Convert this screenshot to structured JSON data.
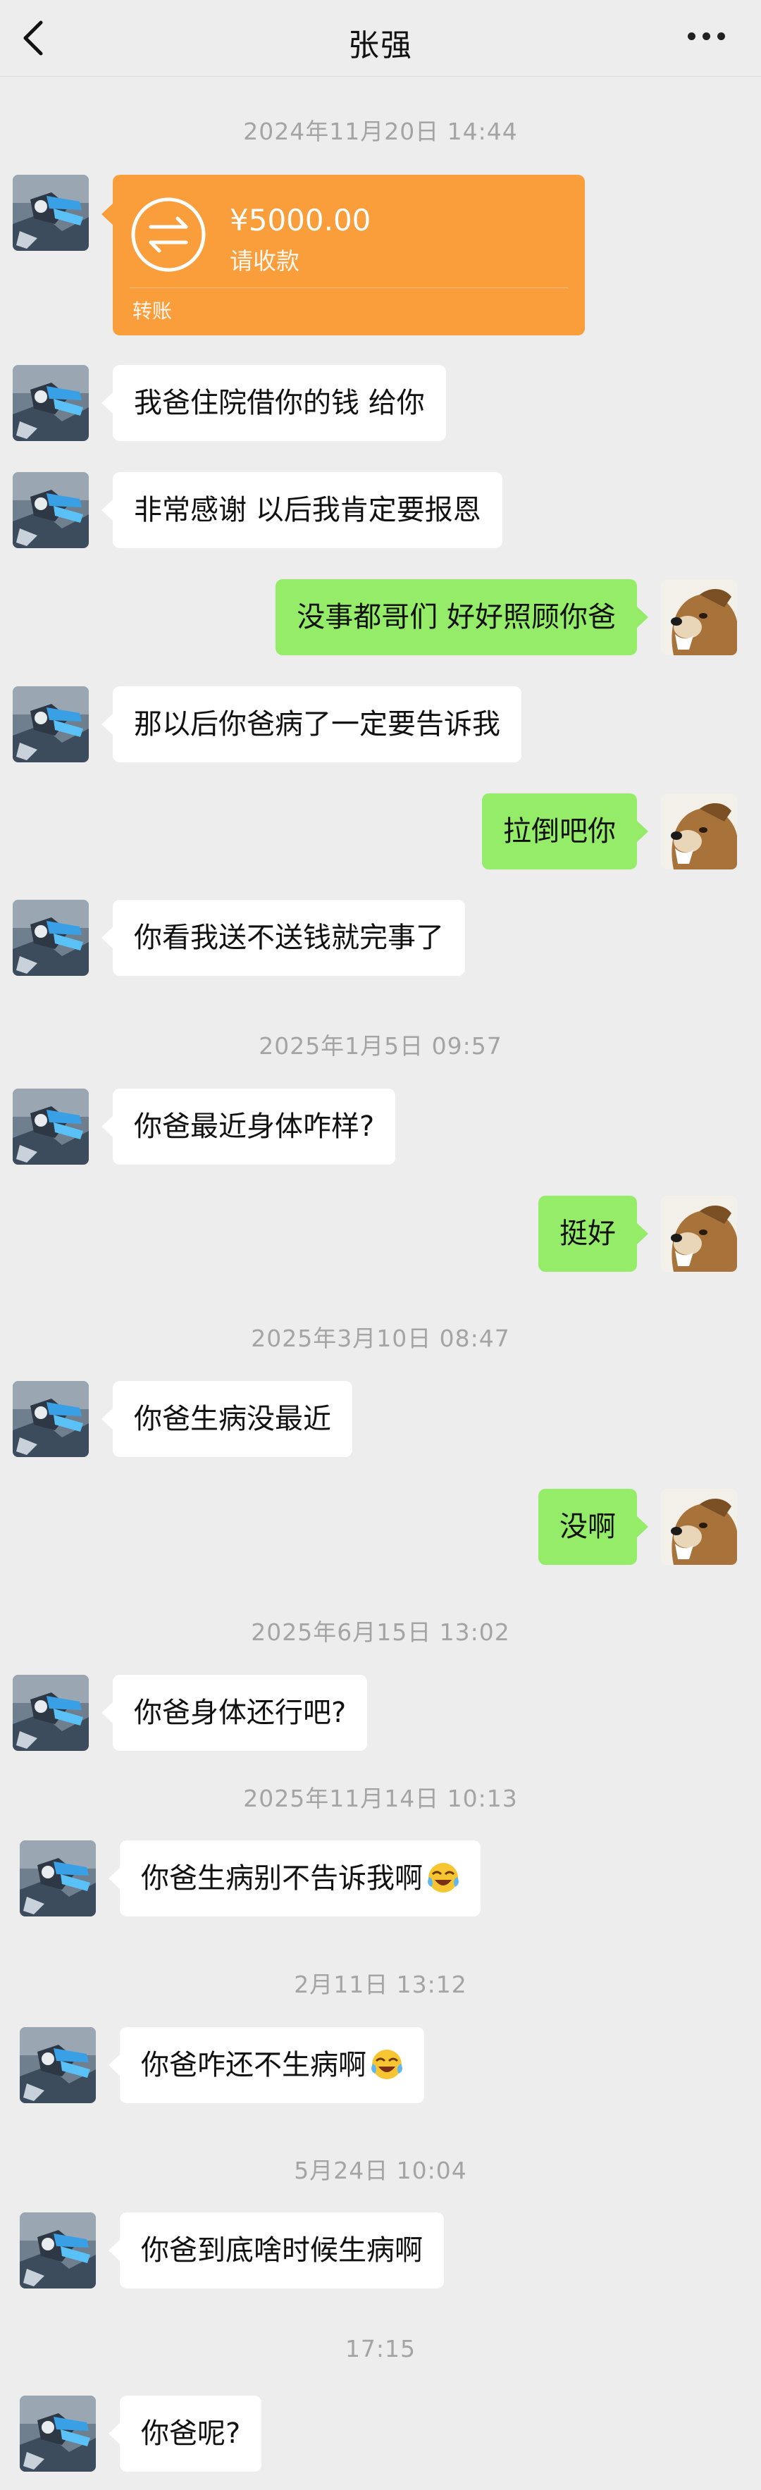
{
  "header": {
    "title": "张强"
  },
  "transfer": {
    "amount": "¥5000.00",
    "status": "请收款",
    "label": "转账"
  },
  "timestamps": {
    "t1": "2024年11月20日 14:44",
    "t2": "2025年1月5日 09:57",
    "t3": "2025年3月10日 08:47",
    "t4": "2025年6月15日 13:02",
    "t5": "2025年11月14日 10:13",
    "t6": "2月11日 13:12",
    "t7": "5月24日 10:04",
    "t8": "17:15"
  },
  "messages": {
    "m1": "我爸住院借你的钱 给你",
    "m2": "非常感谢 以后我肯定要报恩",
    "m3": "没事都哥们 好好照顾你爸",
    "m4": "那以后你爸病了一定要告诉我",
    "m5": "拉倒吧你",
    "m6": "你看我送不送钱就完事了",
    "m7": "你爸最近身体咋样?",
    "m8": "挺好",
    "m9": "你爸生病没最近",
    "m10": "没啊",
    "m11": "你爸身体还行吧?",
    "m12": "你爸生病别不告诉我啊",
    "m13": "你爸咋还不生病啊",
    "m14": "你爸到底啥时候生病啊",
    "m15": "你爸呢?"
  },
  "colors": {
    "background": "#ededed",
    "sent_bubble": "#95ec69",
    "received_bubble": "#ffffff",
    "transfer": "#fa9d3b"
  },
  "icons": {
    "back": "chevron-left-icon",
    "more": "more-dots-icon",
    "transfer": "transfer-arrows-icon",
    "emoji": "laughing-crying-emoji-icon"
  }
}
